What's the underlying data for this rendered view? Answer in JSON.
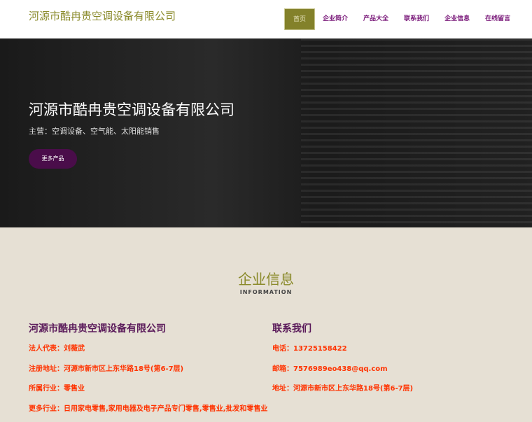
{
  "header": {
    "logo": "河源市酷冉贵空调设备有限公司",
    "nav": [
      "首页",
      "企业简介",
      "产品大全",
      "联系我们",
      "企业信息",
      "在线留言"
    ]
  },
  "hero": {
    "title": "河源市酷冉贵空调设备有限公司",
    "subtitle": "主营：空调设备、空气能、太阳能销售",
    "button": "更多产品"
  },
  "info": {
    "title": "企业信息",
    "subtitle": "INFORMATION",
    "company": {
      "name": "河源市酷冉贵空调设备有限公司",
      "lines": [
        "法人代表：刘薇武",
        "注册地址：河源市新市区上东华路18号(第6-7层)",
        "所属行业：零售业",
        "更多行业：日用家电零售,家用电器及电子产品专门零售,零售业,批发和零售业"
      ]
    },
    "contact": {
      "name": "联系我们",
      "lines": [
        "电话：13725158422",
        "邮箱：7576989eo438@qq.com",
        "地址：河源市新市区上东华路18号(第6-7层)"
      ]
    }
  }
}
